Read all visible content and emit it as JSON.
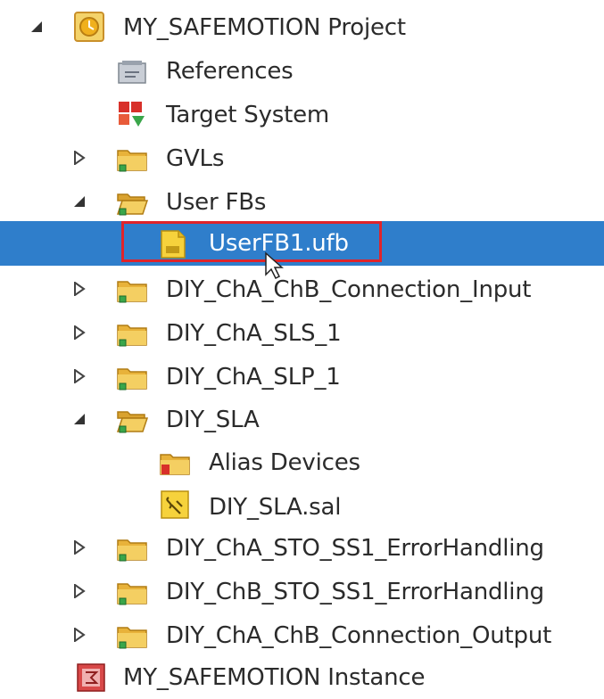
{
  "tree": {
    "items": [
      {
        "label": "MY_SAFEMOTION Project",
        "expander": "expanded",
        "icon": "project-icon"
      },
      {
        "label": "References",
        "expander": "none",
        "icon": "references-icon"
      },
      {
        "label": "Target System",
        "expander": "none",
        "icon": "target-system-icon"
      },
      {
        "label": "GVLs",
        "expander": "collapsed",
        "icon": "folder-icon"
      },
      {
        "label": "User FBs",
        "expander": "expanded",
        "icon": "folder-open-icon"
      },
      {
        "label": "UserFB1.ufb",
        "expander": "none",
        "icon": "ufb-file-icon",
        "selected": true
      },
      {
        "label": "DIY_ChA_ChB_Connection_Input",
        "expander": "collapsed",
        "icon": "folder-icon"
      },
      {
        "label": "DIY_ChA_SLS_1",
        "expander": "collapsed",
        "icon": "folder-icon"
      },
      {
        "label": "DIY_ChA_SLP_1",
        "expander": "collapsed",
        "icon": "folder-icon"
      },
      {
        "label": "DIY_SLA",
        "expander": "expanded",
        "icon": "folder-open-icon"
      },
      {
        "label": "Alias Devices",
        "expander": "none",
        "icon": "alias-devices-folder-icon"
      },
      {
        "label": "DIY_SLA.sal",
        "expander": "none",
        "icon": "sal-file-icon"
      },
      {
        "label": "DIY_ChA_STO_SS1_ErrorHandling",
        "expander": "collapsed",
        "icon": "folder-icon"
      },
      {
        "label": "DIY_ChB_STO_SS1_ErrorHandling",
        "expander": "collapsed",
        "icon": "folder-icon"
      },
      {
        "label": "DIY_ChA_ChB_Connection_Output",
        "expander": "collapsed",
        "icon": "folder-icon"
      },
      {
        "label": "MY_SAFEMOTION Instance",
        "expander": "none",
        "icon": "instance-icon"
      }
    ]
  },
  "colors": {
    "selection": "#2f7ecb",
    "highlight_box": "#e0242a",
    "folder": "#e8b23a",
    "text": "#2b2b2b"
  }
}
